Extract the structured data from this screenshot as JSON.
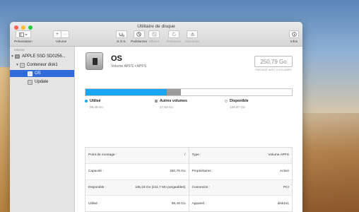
{
  "window": {
    "title": "Utilitaire de disque"
  },
  "toolbar": {
    "presentation_label": "Présentation",
    "volume_label": "Volume",
    "add_symbol": "+",
    "remove_symbol": "−",
    "sos_label": "S.O.S.",
    "partition_label": "Partitionner",
    "erase_label": "Effacer",
    "restore_label": "Restaurer",
    "unmount_label": "Démonter",
    "info_label": "Infos"
  },
  "sidebar": {
    "section": "Interne",
    "items": [
      {
        "label": "APPLE SSD SD0256..."
      },
      {
        "label": "Conteneur disk1"
      },
      {
        "label": "OS"
      },
      {
        "label": "Update"
      }
    ]
  },
  "volume": {
    "name": "OS",
    "subtitle": "Volume APFS • APFS",
    "capacity": "250,79 Go",
    "capacity_note": "PARTAGÉ AVEC 5 VOLUMES"
  },
  "usage": {
    "used_fraction": 0.393,
    "other_fraction": 0.071,
    "colors": {
      "used": "#19a7f2",
      "other": "#9b9b9b",
      "free": "#ffffff"
    },
    "legend": [
      {
        "label": "Utilisé",
        "value": "98,49 Go"
      },
      {
        "label": "Autres volumes",
        "value": "17,53 Go"
      },
      {
        "label": "Disponible",
        "value": "134,97 Go"
      }
    ]
  },
  "info": {
    "left": [
      {
        "key": "Point de montage :",
        "value": "/"
      },
      {
        "key": "Capacité :",
        "value": "250,79 Go"
      },
      {
        "key": "Disponible :",
        "value": "135,18 Go (211,7 Mo purgeables)"
      },
      {
        "key": "Utilisé :",
        "value": "98,49 Go"
      }
    ],
    "right": [
      {
        "key": "Type :",
        "value": "Volume APFS"
      },
      {
        "key": "Propriétaires :",
        "value": "Activé"
      },
      {
        "key": "Connexion :",
        "value": "PCI"
      },
      {
        "key": "Appareil :",
        "value": "disk1s1"
      }
    ]
  }
}
